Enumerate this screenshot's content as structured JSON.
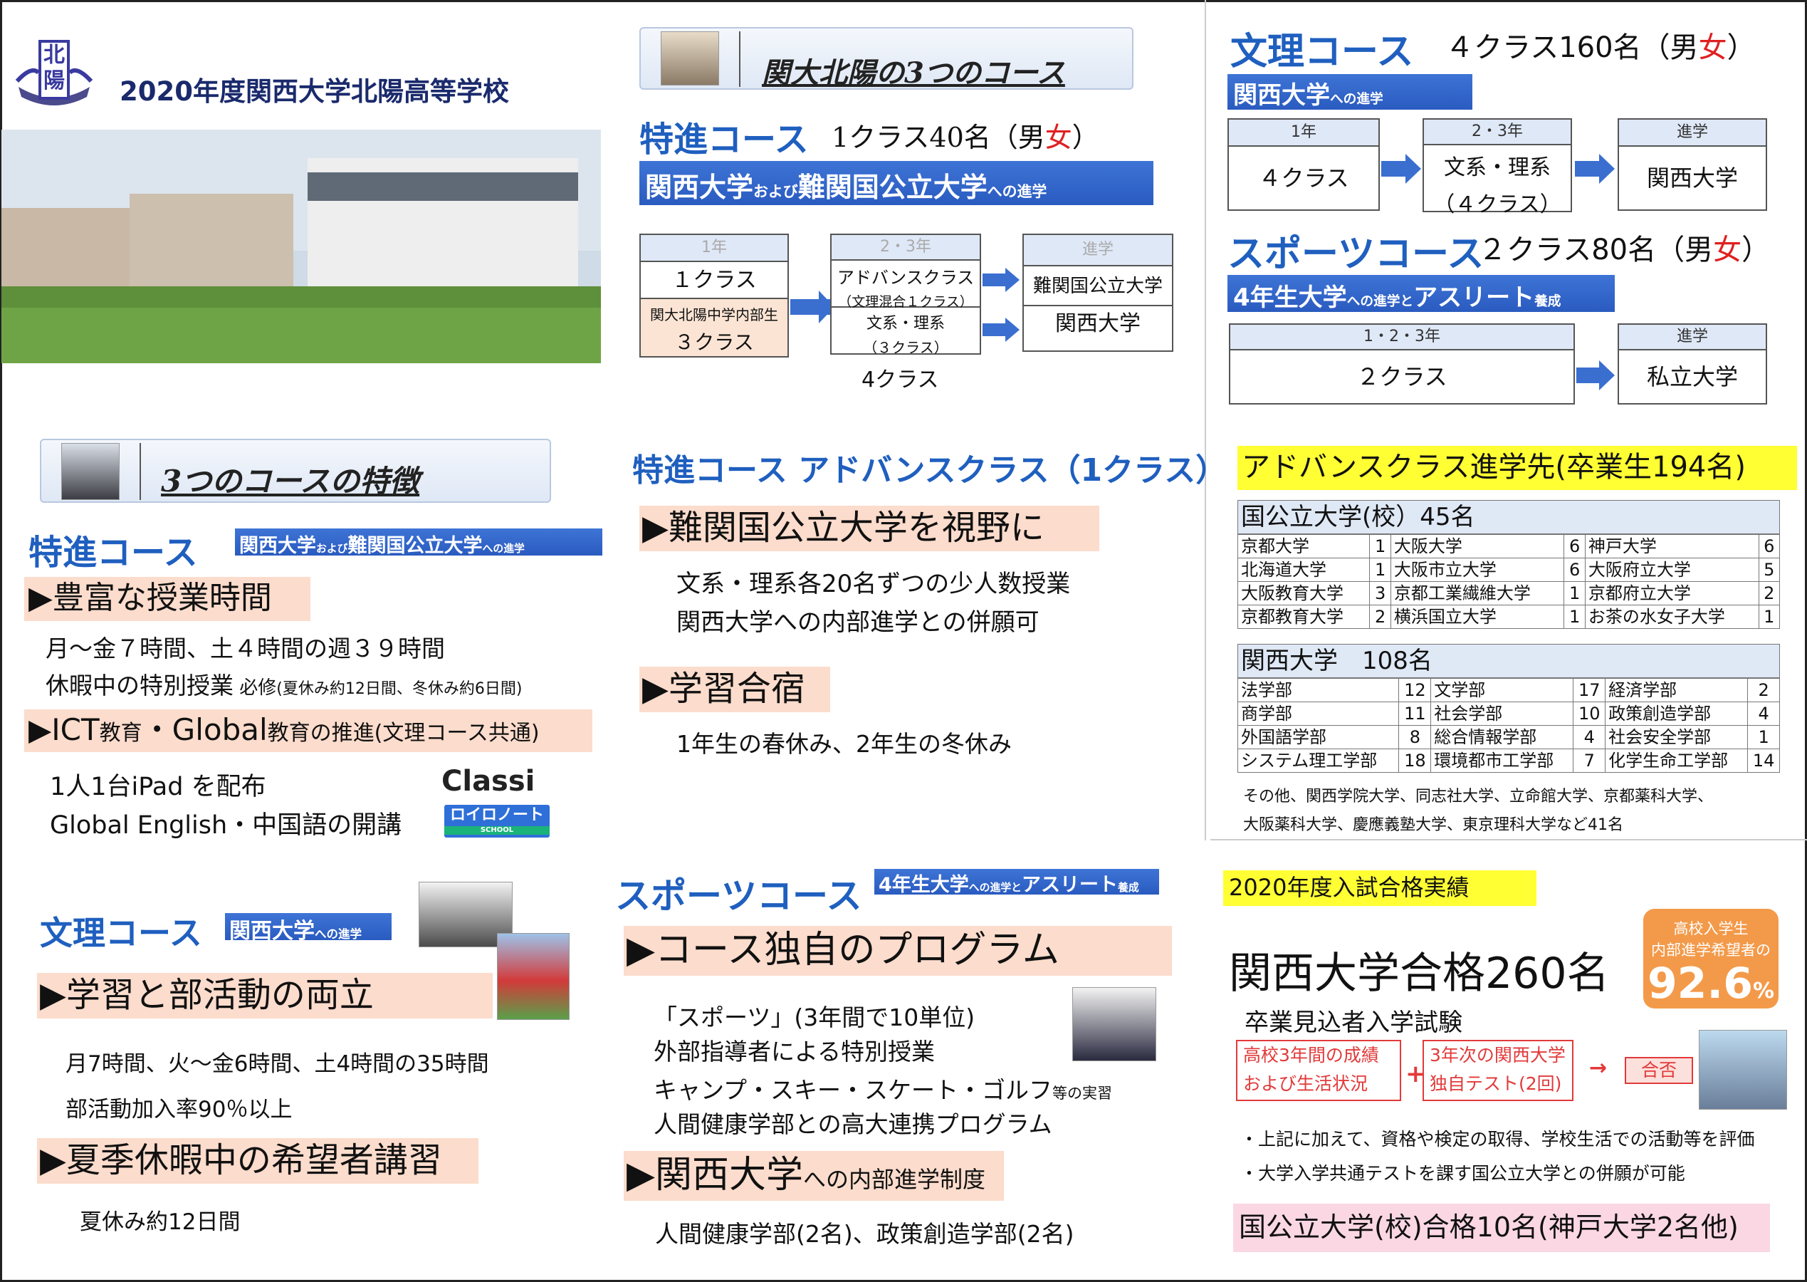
{
  "header": {
    "crest_text": "北陽",
    "title": "2020年度関西大学北陽高等学校"
  },
  "courses_box": {
    "title": "関大北陽の3つのコース"
  },
  "tokushin": {
    "name": "特進コース",
    "count": "1クラス40名（男",
    "girl": "女",
    "close": "）",
    "banner_main": "関西大学",
    "banner_small": "および",
    "banner_main2": "難関国公立大学",
    "banner_small2": "への進学",
    "flow": {
      "y1_head": "1年",
      "y1_class": "１クラス",
      "y1_sub": "関大北陽中学内部生",
      "y1_sub2": "３クラス",
      "y23_head": "2・3年",
      "y23_a": "アドバンスクラス",
      "y23_a2": "（文理混合１クラス）",
      "y23_b": "文系・理系",
      "y23_b2": "（３クラス）",
      "y23_total": "4クラス",
      "out_head": "進学",
      "out_a": "難関国公立大学",
      "out_b": "関西大学"
    }
  },
  "bunri": {
    "name": "文理コース",
    "count": "４クラス160名（男",
    "girl": "女",
    "close": "）",
    "banner": "関西大学",
    "banner_small": "への進学",
    "flow": {
      "y1_head": "1年",
      "y1_class": "４クラス",
      "y23_head": "2・3年",
      "y23_a": "文系・理系",
      "y23_b": "（４クラス）",
      "out_head": "進学",
      "out": "関西大学"
    }
  },
  "sports": {
    "name": "スポーツコース",
    "count": "２クラス80名（男",
    "girl": "女",
    "close": "）",
    "banner": "4年生大学",
    "banner_small": "への進学と",
    "banner2": "アスリート",
    "banner_small2": "養成",
    "flow": {
      "y_head": "1・2・3年",
      "y_class": "２クラス",
      "out_head": "進学",
      "out": "私立大学"
    }
  },
  "features_box": {
    "title": "3つのコースの特徴"
  },
  "feat_tokushin": {
    "name": "特進コース",
    "banner": "関西大学",
    "banner_s": "および",
    "banner2": "難関国公立大学",
    "banner_s2": "への進学",
    "h1": "▶豊富な授業時間",
    "t1": "月～金７時間、土４時間の週３９時間",
    "t2a": "休暇中の特別授業",
    "t2b": "必修",
    "t2c": "(夏休み約12日間、冬休み約6日間)",
    "h2a": "▶ICT",
    "h2b": "教育",
    "h2c": "・Global",
    "h2d": "教育の推進(文理コース共通)",
    "t3": "1人1台iPad を配布",
    "t4": "Global English・中国語の開講",
    "logo1": "Classi",
    "logo2": "ロイロノート",
    "logo2s": "SCHOOL"
  },
  "advance": {
    "title": "特進コース  アドバンスクラス（1クラス）",
    "h1": "▶難関国公立大学を視野に",
    "t1": "文系・理系各20名ずつの少人数授業",
    "t2": "関西大学への内部進学との併願可",
    "h2": "▶学習合宿",
    "t3": "1年生の春休み、2年生の冬休み"
  },
  "results": {
    "title": "アドバンスクラス進学先(卒業生194名)",
    "national_head": "国公立大学(校）45名",
    "national": [
      [
        "京都大学",
        "1",
        "大阪大学",
        "6",
        "神戸大学",
        "6"
      ],
      [
        "北海道大学",
        "1",
        "大阪市立大学",
        "6",
        "大阪府立大学",
        "5"
      ],
      [
        "大阪教育大学",
        "3",
        "京都工業繊維大学",
        "1",
        "京都府立大学",
        "2"
      ],
      [
        "京都教育大学",
        "2",
        "横浜国立大学",
        "1",
        "お茶の水女子大学",
        "1"
      ]
    ],
    "kandai_head": "関西大学　108名",
    "kandai": [
      [
        "法学部",
        "12",
        "文学部",
        "17",
        "経済学部",
        "2"
      ],
      [
        "商学部",
        "11",
        "社会学部",
        "10",
        "政策創造学部",
        "4"
      ],
      [
        "外国語学部",
        "8",
        "総合情報学部",
        "4",
        "社会安全学部",
        "1"
      ],
      [
        "システム理工学部",
        "18",
        "環境都市工学部",
        "7",
        "化学生命工学部",
        "14"
      ]
    ],
    "other1": "その他、関西学院大学、同志社大学、立命館大学、京都薬科大学、",
    "other2": "大阪薬科大学、慶應義塾大学、東京理科大学など41名"
  },
  "feat_bunri": {
    "name": "文理コース",
    "banner": "関西大学",
    "banner_s": "への進学",
    "h1": "▶学習と部活動の両立",
    "t1": "月7時間、火～金6時間、土4時間の35時間",
    "t2": "部活動加入率90％以上",
    "h2": "▶夏季休暇中の希望者講習",
    "t3": "夏休み約12日間"
  },
  "feat_sports": {
    "name": "スポーツコース",
    "banner": "4年生大学",
    "banner_s": "への進学と",
    "banner2": "アスリート",
    "banner_s2": "養成",
    "h1": "▶コース独自のプログラム",
    "t1": "「スポーツ」(3年間で10単位)",
    "t2": "外部指導者による特別授業",
    "t3a": "キャンプ・スキー・スケート・ゴルフ",
    "t3b": "等の実習",
    "t4": "人間健康学部との高大連携プログラム",
    "h2a": "▶関西大学",
    "h2b": "への内部進学制度",
    "t5": "人間健康学部(2名)、政策創造学部(2名)"
  },
  "exam": {
    "title": "2020年度入試合格実績",
    "badge1": "高校入学生",
    "badge2": "内部進学希望者の",
    "badge_num": "92.6",
    "badge_pct": "%",
    "big": "関西大学合格260名",
    "sub": "卒業見込者入学試験",
    "box1a": "高校3年間の成績",
    "box1b": "および生活状況",
    "plus": "+",
    "box2a": "3年次の関西大学",
    "box2b": "独自テスト(2回)",
    "arrow": "→",
    "result": "合否",
    "note1": "・上記に加えて、資格や検定の取得、学校生活での活動等を評価",
    "note2": "・大学入学共通テストを課す国公立大学との併願が可能",
    "national": "国公立大学(校)合格10名(神戸大学2名他)"
  },
  "colors": {
    "blue": "#1f5fbf",
    "girl": "#e02020",
    "peach": "#fcdccc",
    "yellow": "#ffff33",
    "orange": "#f39a4a",
    "pink": "#fbd7e4"
  }
}
